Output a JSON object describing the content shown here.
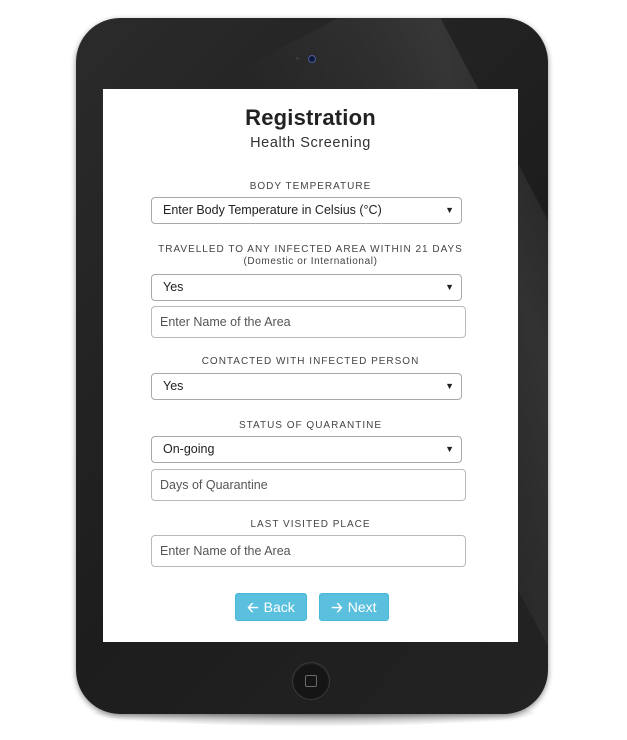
{
  "form": {
    "title": "Registration",
    "subtitle": "Health Screening"
  },
  "fields": {
    "body_temperature": {
      "label": "BODY TEMPERATURE",
      "selected": "Enter Body Temperature in Celsius (°C)"
    },
    "travelled": {
      "label": "TRAVELLED TO ANY INFECTED AREA WITHIN 21 DAYS",
      "sublabel": "(Domestic or International)",
      "selected": "Yes",
      "area_placeholder": "Enter Name of the Area"
    },
    "contacted": {
      "label": "CONTACTED WITH INFECTED PERSON",
      "selected": "Yes"
    },
    "quarantine": {
      "label": "STATUS OF QUARANTINE",
      "selected": "On-going",
      "days_placeholder": "Days of Quarantine"
    },
    "last_visited": {
      "label": "LAST VISITED PLACE",
      "placeholder": "Enter Name of the Area"
    }
  },
  "buttons": {
    "back": {
      "label": "Back",
      "icon": "arrow-left-icon"
    },
    "next": {
      "label": "Next",
      "icon": "arrow-right-icon"
    }
  },
  "colors": {
    "accent": "#5bc0de",
    "device": "#1f1f1f"
  }
}
